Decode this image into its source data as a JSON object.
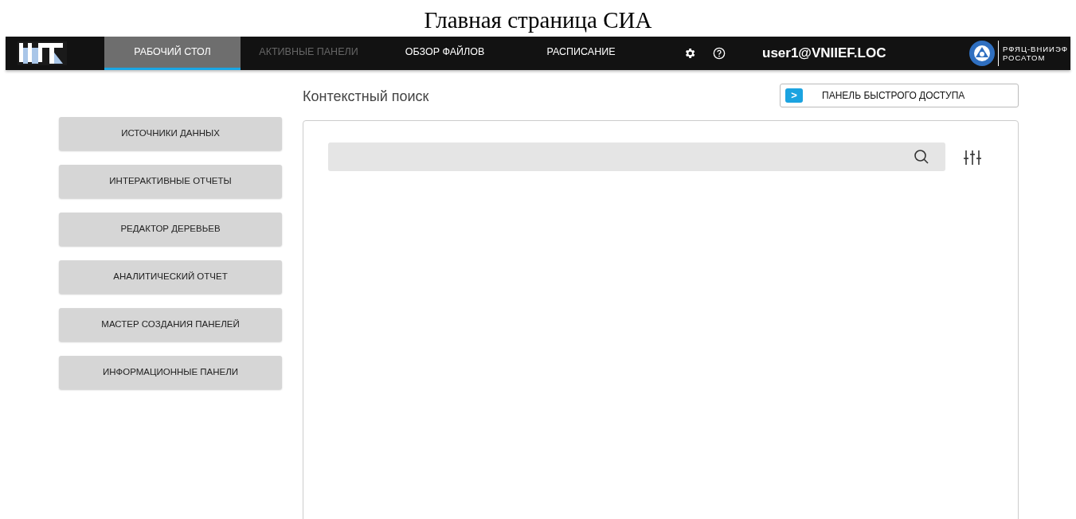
{
  "page_title": "Главная страница СИА",
  "nav": {
    "tabs": [
      {
        "label": "РАБОЧИЙ СТОЛ",
        "selected": true,
        "disabled": false
      },
      {
        "label": "АКТИВНЫЕ ПАНЕЛИ",
        "selected": false,
        "disabled": true
      },
      {
        "label": "ОБЗОР ФАЙЛОВ",
        "selected": false,
        "disabled": false
      },
      {
        "label": "РАСПИСАНИЕ",
        "selected": false,
        "disabled": false
      }
    ],
    "user": "user1@VNIIEF.LOC",
    "org_lines": [
      "РФЯЦ-ВНИИЭФ",
      "РОСАТОМ"
    ]
  },
  "sidebar": {
    "items": [
      "ИСТОЧНИКИ ДАННЫХ",
      "ИНТЕРАКТИВНЫЕ ОТЧЕТЫ",
      "РЕДАКТОР ДЕРЕВЬЕВ",
      "АНАЛИТИЧЕСКИЙ ОТЧЕТ",
      "МАСТЕР СОЗДАНИЯ ПАНЕЛЕЙ",
      "ИНФОРМАЦИОННЫЕ ПАНЕЛИ"
    ]
  },
  "search_section": {
    "heading": "Контекстный поиск",
    "quick_access_button": "ПАНЕЛЬ БЫСТРОГО ДОСТУПА",
    "chevron": ">"
  }
}
